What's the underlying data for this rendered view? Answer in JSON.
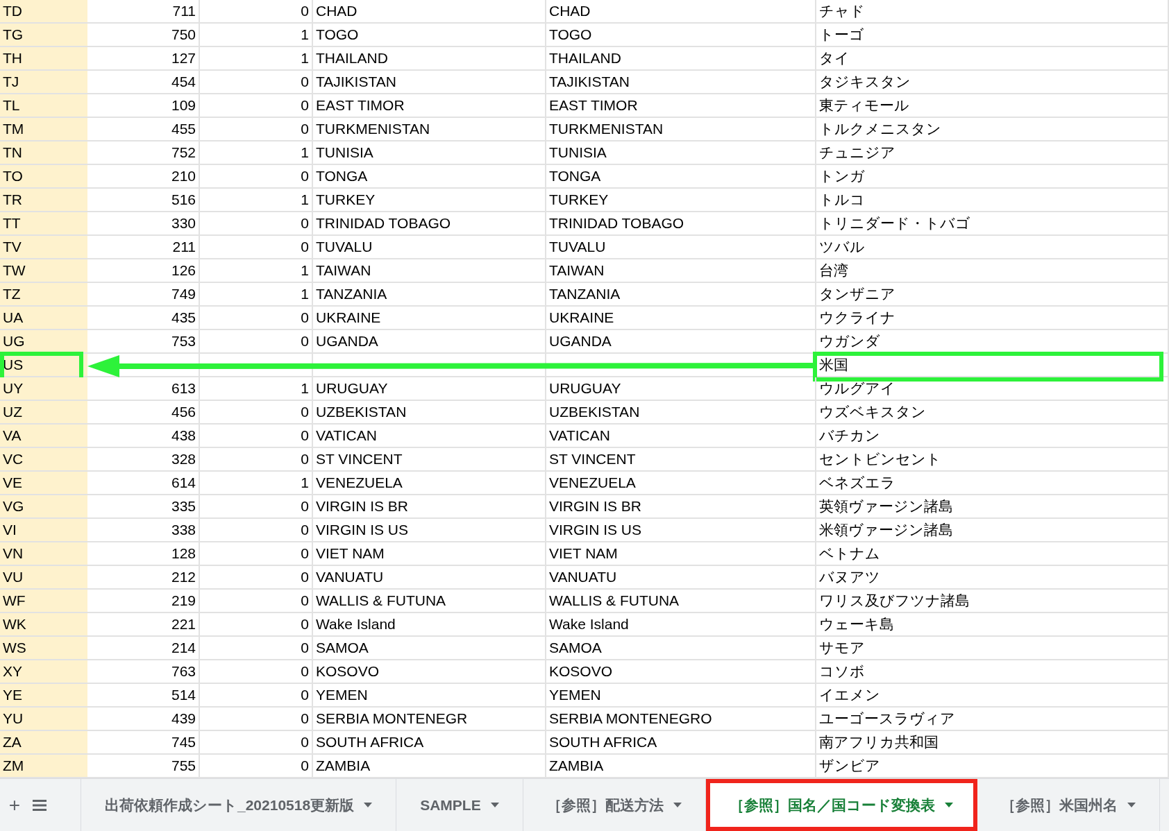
{
  "table": {
    "rows": [
      {
        "column_1": "TD",
        "column_2": "711",
        "column_3": "0",
        "column_4": "CHAD",
        "column_5": "CHAD",
        "column_6": "チャド",
        "highlighted": false
      },
      {
        "column_1": "TG",
        "column_2": "750",
        "column_3": "1",
        "column_4": "TOGO",
        "column_5": "TOGO",
        "column_6": "トーゴ",
        "highlighted": false
      },
      {
        "column_1": "TH",
        "column_2": "127",
        "column_3": "1",
        "column_4": "THAILAND",
        "column_5": "THAILAND",
        "column_6": "タイ",
        "highlighted": false
      },
      {
        "column_1": "TJ",
        "column_2": "454",
        "column_3": "0",
        "column_4": "TAJIKISTAN",
        "column_5": "TAJIKISTAN",
        "column_6": "タジキスタン",
        "highlighted": false
      },
      {
        "column_1": "TL",
        "column_2": "109",
        "column_3": "0",
        "column_4": "EAST TIMOR",
        "column_5": "EAST TIMOR",
        "column_6": "東ティモール",
        "highlighted": false
      },
      {
        "column_1": "TM",
        "column_2": "455",
        "column_3": "0",
        "column_4": "TURKMENISTAN",
        "column_5": "TURKMENISTAN",
        "column_6": "トルクメニスタン",
        "highlighted": false
      },
      {
        "column_1": "TN",
        "column_2": "752",
        "column_3": "1",
        "column_4": "TUNISIA",
        "column_5": "TUNISIA",
        "column_6": "チュニジア",
        "highlighted": false
      },
      {
        "column_1": "TO",
        "column_2": "210",
        "column_3": "0",
        "column_4": "TONGA",
        "column_5": "TONGA",
        "column_6": "トンガ",
        "highlighted": false
      },
      {
        "column_1": "TR",
        "column_2": "516",
        "column_3": "1",
        "column_4": "TURKEY",
        "column_5": "TURKEY",
        "column_6": "トルコ",
        "highlighted": false
      },
      {
        "column_1": "TT",
        "column_2": "330",
        "column_3": "0",
        "column_4": "TRINIDAD TOBAGO",
        "column_5": "TRINIDAD TOBAGO",
        "column_6": "トリニダード・トバゴ",
        "highlighted": false
      },
      {
        "column_1": "TV",
        "column_2": "211",
        "column_3": "0",
        "column_4": "TUVALU",
        "column_5": "TUVALU",
        "column_6": "ツバル",
        "highlighted": false
      },
      {
        "column_1": "TW",
        "column_2": "126",
        "column_3": "1",
        "column_4": "TAIWAN",
        "column_5": "TAIWAN",
        "column_6": "台湾",
        "highlighted": false
      },
      {
        "column_1": "TZ",
        "column_2": "749",
        "column_3": "1",
        "column_4": "TANZANIA",
        "column_5": "TANZANIA",
        "column_6": "タンザニア",
        "highlighted": false
      },
      {
        "column_1": "UA",
        "column_2": "435",
        "column_3": "0",
        "column_4": "UKRAINE",
        "column_5": "UKRAINE",
        "column_6": "ウクライナ",
        "highlighted": false
      },
      {
        "column_1": "UG",
        "column_2": "753",
        "column_3": "0",
        "column_4": "UGANDA",
        "column_5": "UGANDA",
        "column_6": "ウガンダ",
        "highlighted": false
      },
      {
        "column_1": "US",
        "column_6": "米国",
        "highlighted": true
      },
      {
        "column_1": "UY",
        "column_2": "613",
        "column_3": "1",
        "column_4": "URUGUAY",
        "column_5": "URUGUAY",
        "column_6": "ウルグアイ",
        "highlighted": false
      },
      {
        "column_1": "UZ",
        "column_2": "456",
        "column_3": "0",
        "column_4": "UZBEKISTAN",
        "column_5": "UZBEKISTAN",
        "column_6": "ウズベキスタン",
        "highlighted": false
      },
      {
        "column_1": "VA",
        "column_2": "438",
        "column_3": "0",
        "column_4": "VATICAN",
        "column_5": "VATICAN",
        "column_6": "バチカン",
        "highlighted": false
      },
      {
        "column_1": "VC",
        "column_2": "328",
        "column_3": "0",
        "column_4": "ST VINCENT",
        "column_5": "ST VINCENT",
        "column_6": "セントビンセント",
        "highlighted": false
      },
      {
        "column_1": "VE",
        "column_2": "614",
        "column_3": "1",
        "column_4": "VENEZUELA",
        "column_5": "VENEZUELA",
        "column_6": "ベネズエラ",
        "highlighted": false
      },
      {
        "column_1": "VG",
        "column_2": "335",
        "column_3": "0",
        "column_4": "VIRGIN IS BR",
        "column_5": "VIRGIN IS BR",
        "column_6": "英領ヴァージン諸島",
        "highlighted": false
      },
      {
        "column_1": "VI",
        "column_2": "338",
        "column_3": "0",
        "column_4": "VIRGIN IS US",
        "column_5": "VIRGIN IS US",
        "column_6": "米領ヴァージン諸島",
        "highlighted": false
      },
      {
        "column_1": "VN",
        "column_2": "128",
        "column_3": "0",
        "column_4": "VIET NAM",
        "column_5": "VIET NAM",
        "column_6": "ベトナム",
        "highlighted": false
      },
      {
        "column_1": "VU",
        "column_2": "212",
        "column_3": "0",
        "column_4": "VANUATU",
        "column_5": "VANUATU",
        "column_6": "バヌアツ",
        "highlighted": false
      },
      {
        "column_1": "WF",
        "column_2": "219",
        "column_3": "0",
        "column_4": "WALLIS & FUTUNA",
        "column_5": "WALLIS & FUTUNA",
        "column_6": "ワリス及びフツナ諸島",
        "highlighted": false
      },
      {
        "column_1": "WK",
        "column_2": "221",
        "column_3": "0",
        "column_4": "Wake Island",
        "column_5": "Wake Island",
        "column_6": "ウェーキ島",
        "highlighted": false
      },
      {
        "column_1": "WS",
        "column_2": "214",
        "column_3": "0",
        "column_4": "SAMOA",
        "column_5": "SAMOA",
        "column_6": "サモア",
        "highlighted": false
      },
      {
        "column_1": "XY",
        "column_2": "763",
        "column_3": "0",
        "column_4": "KOSOVO",
        "column_5": "KOSOVO",
        "column_6": "コソボ",
        "highlighted": false
      },
      {
        "column_1": "YE",
        "column_2": "514",
        "column_3": "0",
        "column_4": "YEMEN",
        "column_5": "YEMEN",
        "column_6": "イエメン",
        "highlighted": false
      },
      {
        "column_1": "YU",
        "column_2": "439",
        "column_3": "0",
        "column_4": "SERBIA MONTENEGR",
        "column_5": "SERBIA MONTENEGRO",
        "column_6": "ユーゴースラヴィア",
        "highlighted": false
      },
      {
        "column_1": "ZA",
        "column_2": "745",
        "column_3": "0",
        "column_4": "SOUTH AFRICA",
        "column_5": "SOUTH AFRICA",
        "column_6": "南アフリカ共和国",
        "highlighted": false
      },
      {
        "column_1": "ZM",
        "column_2": "755",
        "column_3": "0",
        "column_4": "ZAMBIA",
        "column_5": "ZAMBIA",
        "column_6": "ザンビア",
        "highlighted": false
      }
    ]
  },
  "sheet_tabs": {
    "add_label": "+",
    "tabs": [
      {
        "label": "出荷依頼作成シート_20210518更新版",
        "selected": false,
        "highlighted": false
      },
      {
        "label": "SAMPLE",
        "selected": false,
        "highlighted": false
      },
      {
        "label": "［参照］配送方法",
        "selected": false,
        "highlighted": false
      },
      {
        "label": "［参照］国名／国コード変換表",
        "selected": true,
        "highlighted": true
      },
      {
        "label": "［参照］米国州名",
        "selected": false,
        "highlighted": false
      }
    ]
  }
}
